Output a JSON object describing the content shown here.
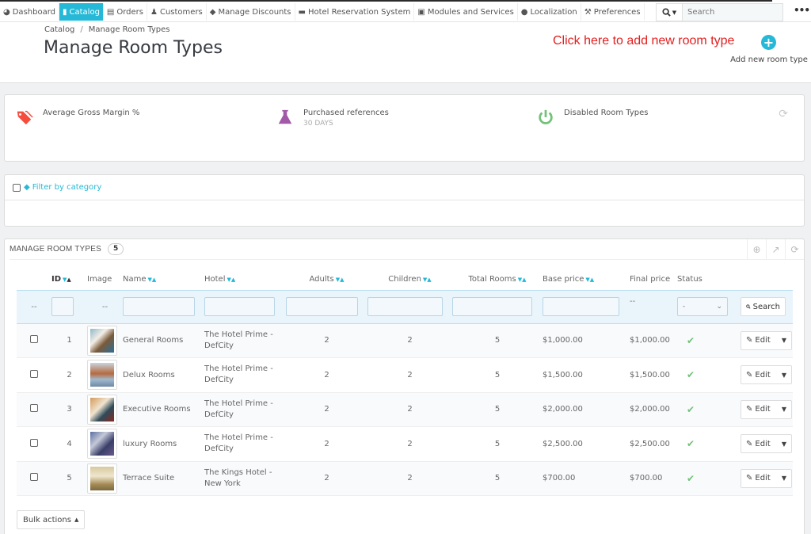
{
  "nav": {
    "items": [
      {
        "label": "Dashboard",
        "icon": "dashboard-icon",
        "active": false
      },
      {
        "label": "Catalog",
        "icon": "book-icon",
        "active": true
      },
      {
        "label": "Orders",
        "icon": "credit-card-icon",
        "active": false
      },
      {
        "label": "Customers",
        "icon": "users-icon",
        "active": false
      },
      {
        "label": "Manage Discounts",
        "icon": "tag-icon",
        "active": false
      },
      {
        "label": "Hotel Reservation System",
        "icon": "bed-icon",
        "active": false
      },
      {
        "label": "Modules and Services",
        "icon": "puzzle-icon",
        "active": false
      },
      {
        "label": "Localization",
        "icon": "globe-icon",
        "active": false
      },
      {
        "label": "Preferences",
        "icon": "wrench-icon",
        "active": false
      }
    ],
    "search_placeholder": "Search",
    "more": "•••"
  },
  "header": {
    "breadcrumb": [
      "Catalog",
      "Manage Room Types"
    ],
    "breadcrumb_sep": "/",
    "title": "Manage Room Types",
    "hint": "Click here to add new room type",
    "add_label": "Add new room type"
  },
  "kpis": [
    {
      "title": "Average Gross Margin %",
      "subtitle": "",
      "color": "#f54c3e"
    },
    {
      "title": "Purchased references",
      "subtitle": "30 DAYS",
      "color": "#a25aa8"
    },
    {
      "title": "Disabled Room Types",
      "subtitle": "",
      "color": "#72c279"
    }
  ],
  "filter": {
    "label": "Filter by category"
  },
  "list": {
    "title": "MANAGE ROOM TYPES",
    "count": "5",
    "columns": [
      "ID",
      "Image",
      "Name",
      "Hotel",
      "Adults",
      "Children",
      "Total Rooms",
      "Base price",
      "Final price",
      "Status"
    ],
    "filter_placeholder_dash": "--",
    "status_filter_value": "-",
    "search_label": "Search",
    "rows": [
      {
        "id": "1",
        "name": "General Rooms",
        "hotel_line1": "The Hotel Prime -",
        "hotel_line2": "DefCity",
        "adults": "2",
        "children": "2",
        "total_rooms": "5",
        "base_price": "$1,000.00",
        "final_price": "$1,000.00",
        "status": "enabled"
      },
      {
        "id": "2",
        "name": "Delux Rooms",
        "hotel_line1": "The Hotel Prime -",
        "hotel_line2": "DefCity",
        "adults": "2",
        "children": "2",
        "total_rooms": "5",
        "base_price": "$1,500.00",
        "final_price": "$1,500.00",
        "status": "enabled"
      },
      {
        "id": "3",
        "name": "Executive Rooms",
        "hotel_line1": "The Hotel Prime -",
        "hotel_line2": "DefCity",
        "adults": "2",
        "children": "2",
        "total_rooms": "5",
        "base_price": "$2,000.00",
        "final_price": "$2,000.00",
        "status": "enabled"
      },
      {
        "id": "4",
        "name": "luxury Rooms",
        "hotel_line1": "The Hotel Prime -",
        "hotel_line2": "DefCity",
        "adults": "2",
        "children": "2",
        "total_rooms": "5",
        "base_price": "$2,500.00",
        "final_price": "$2,500.00",
        "status": "enabled"
      },
      {
        "id": "5",
        "name": "Terrace Suite",
        "hotel_line1": "The Kings Hotel -",
        "hotel_line2": "New York",
        "adults": "2",
        "children": "2",
        "total_rooms": "5",
        "base_price": "$700.00",
        "final_price": "$700.00",
        "status": "enabled"
      }
    ],
    "edit_label": "Edit",
    "bulk_label": "Bulk actions"
  },
  "colors": {
    "accent": "#25b9d7",
    "hint": "#e31e1e",
    "enabled": "#72c279"
  }
}
